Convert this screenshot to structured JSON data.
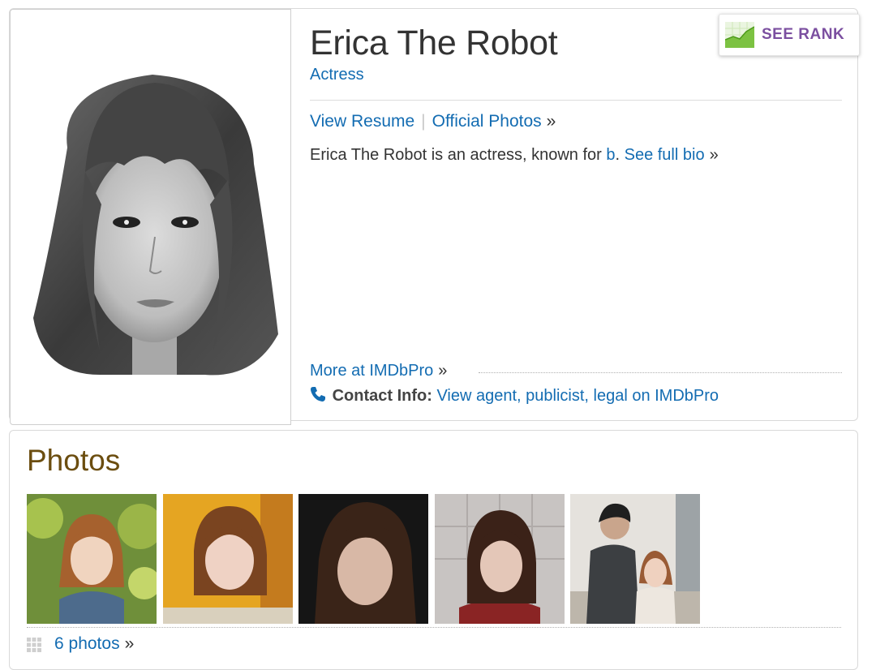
{
  "profile": {
    "name": "Erica The Robot",
    "job": "Actress",
    "view_resume": "View Resume",
    "official_photos": "Official Photos",
    "raquo": "»",
    "bio_text": "Erica The Robot is an actress, known for ",
    "bio_film": "b",
    "bio_period": ".",
    "see_full_bio": "See full bio",
    "more_imdbpro": "More at IMDbPro",
    "contact_label": "Contact Info:",
    "contact_link": "View agent, publicist, legal on IMDbPro",
    "see_rank": "SEE RANK",
    "portrait_icon": "portrait-photo"
  },
  "photos": {
    "title": "Photos",
    "count_link": "6 photos",
    "raquo": "»",
    "thumbs": [
      {
        "icon": "photo-thumb-1"
      },
      {
        "icon": "photo-thumb-2"
      },
      {
        "icon": "photo-thumb-3"
      },
      {
        "icon": "photo-thumb-4"
      },
      {
        "icon": "photo-thumb-5"
      }
    ]
  },
  "colors": {
    "link": "#136cb2",
    "photos_heading": "#6b4d0f",
    "see_rank": "#7b4fa0",
    "rank_icon": "#7cc242"
  }
}
